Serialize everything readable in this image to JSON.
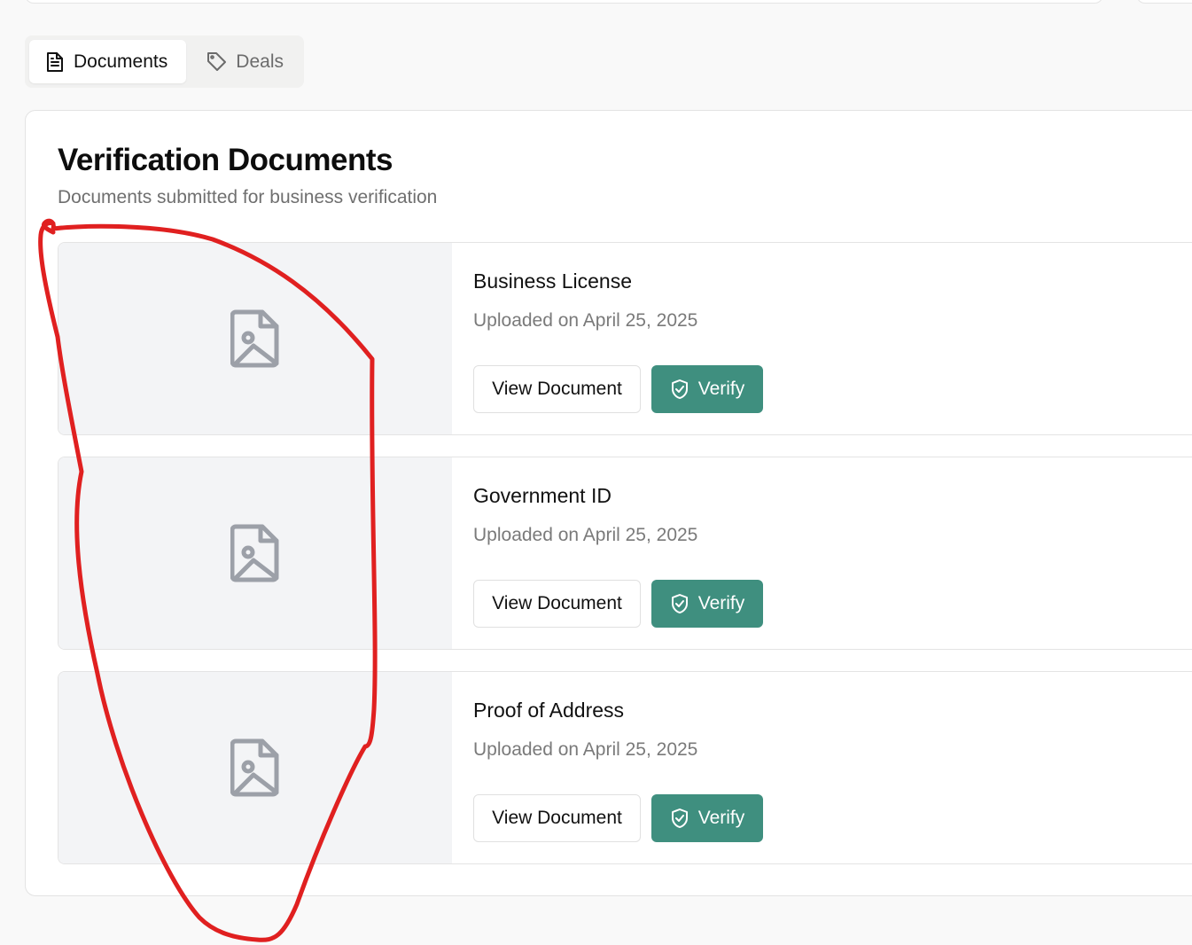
{
  "tabs": [
    {
      "label": "Documents",
      "icon": "document-icon",
      "active": true
    },
    {
      "label": "Deals",
      "icon": "tag-icon",
      "active": false
    }
  ],
  "panel": {
    "title": "Verification Documents",
    "subtitle": "Documents submitted for business verification"
  },
  "documents": [
    {
      "name": "Business License",
      "date": "Uploaded on April 25, 2025",
      "view_label": "View Document",
      "verify_label": "Verify"
    },
    {
      "name": "Government ID",
      "date": "Uploaded on April 25, 2025",
      "view_label": "View Document",
      "verify_label": "Verify"
    },
    {
      "name": "Proof of Address",
      "date": "Uploaded on April 25, 2025",
      "view_label": "View Document",
      "verify_label": "Verify"
    }
  ],
  "colors": {
    "accent": "#3f8f7f",
    "annotation": "#e02020",
    "thumb_bg": "#f3f4f6"
  }
}
